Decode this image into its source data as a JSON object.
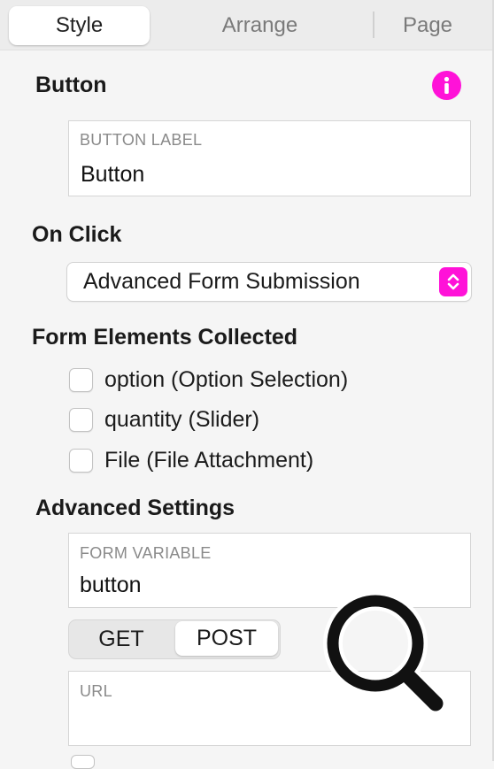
{
  "tabs": [
    {
      "label": "Style",
      "active": true
    },
    {
      "label": "Arrange",
      "active": false
    },
    {
      "label": "Page",
      "active": false
    }
  ],
  "colors": {
    "accent": "#ff12d8",
    "panel": "#f5f5f5"
  },
  "button_section": {
    "title": "Button",
    "info_icon": "info-icon",
    "label_field": {
      "label": "BUTTON LABEL",
      "value": "Button"
    }
  },
  "on_click": {
    "title": "On Click",
    "selected": "Advanced Form Submission",
    "stepper_icon": "chevron-up-down-icon"
  },
  "form_elements": {
    "title": "Form Elements Collected",
    "items": [
      {
        "label": "option (Option Selection)",
        "checked": false
      },
      {
        "label": "quantity (Slider)",
        "checked": false
      },
      {
        "label": "File (File Attachment)",
        "checked": false
      }
    ]
  },
  "advanced": {
    "title": "Advanced Settings",
    "form_variable": {
      "label": "FORM VARIABLE",
      "value": "button"
    },
    "methods": [
      "GET",
      "POST"
    ],
    "selected_method": "POST",
    "url": {
      "label": "URL",
      "value": ""
    }
  },
  "overlay_icon": "magnifier-icon"
}
